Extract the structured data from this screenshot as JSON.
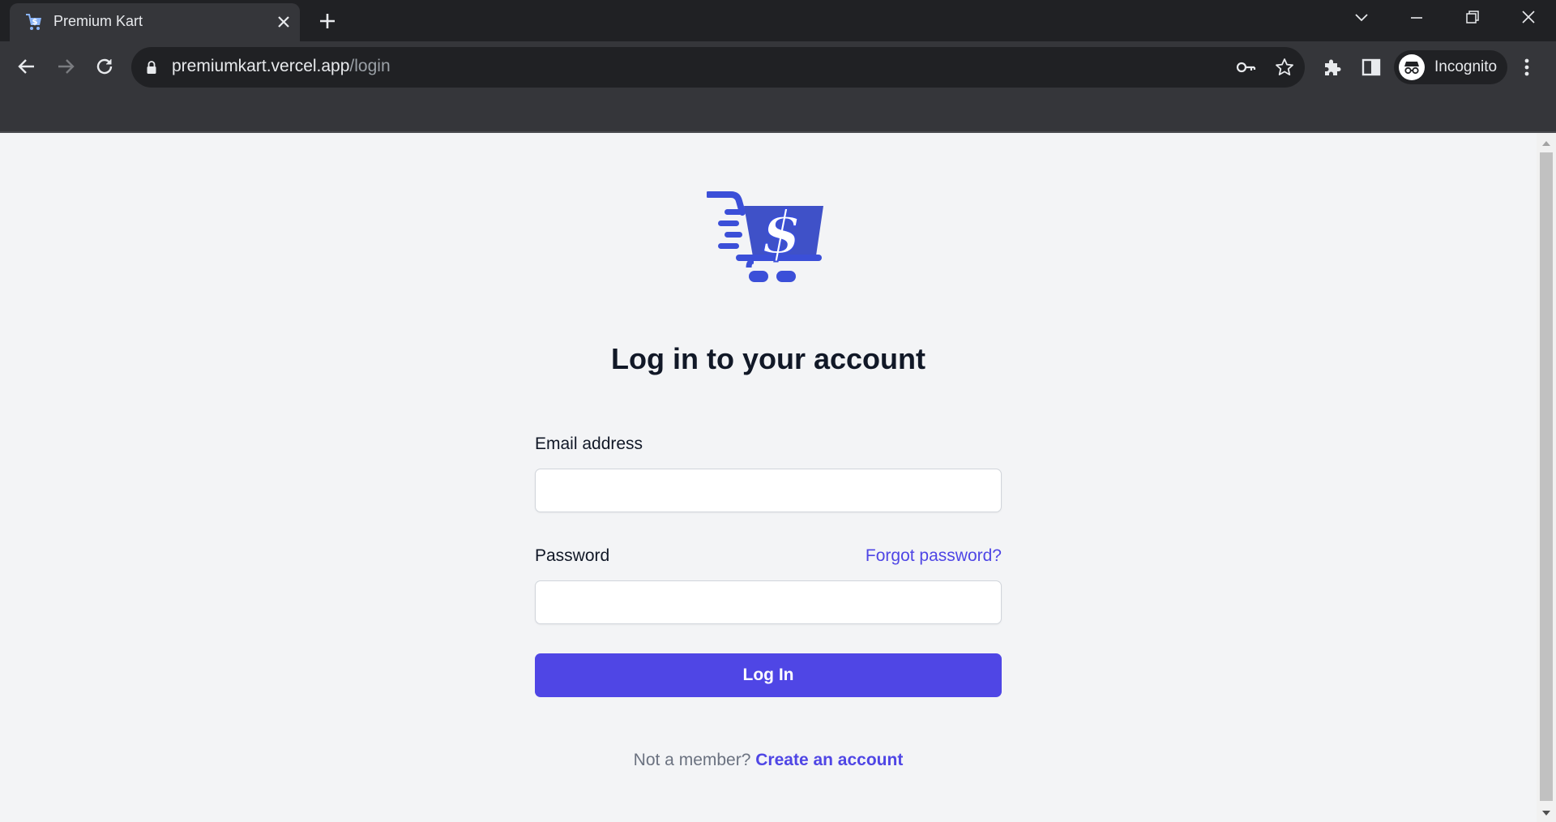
{
  "browser": {
    "tab_title": "Premium Kart",
    "url_host": "premiumkart.vercel.app",
    "url_path": "/login",
    "profile_label": "Incognito"
  },
  "page": {
    "heading": "Log in to your account",
    "email_label": "Email address",
    "email_value": "",
    "password_label": "Password",
    "password_value": "",
    "forgot_link": "Forgot password?",
    "login_button": "Log In",
    "member_prompt": "Not a member?",
    "create_account_link": "Create an account"
  },
  "colors": {
    "brand": "#4f46e5",
    "logo_blue": "#3b4fd8",
    "page_bg": "#f3f4f6",
    "chrome_dark": "#202124"
  },
  "icons": {
    "back": "arrow-left-icon",
    "forward": "arrow-right-icon",
    "reload": "reload-icon",
    "lock": "lock-icon",
    "key": "key-icon",
    "star": "star-icon",
    "extensions": "puzzle-icon",
    "side_panel": "side-panel-icon",
    "incognito": "incognito-icon",
    "menu": "kebab-menu-icon"
  }
}
